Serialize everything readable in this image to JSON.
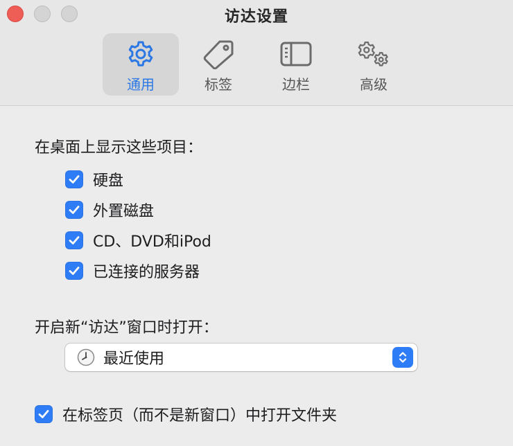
{
  "window": {
    "title": "访达设置"
  },
  "tabs": [
    {
      "label": "通用",
      "icon": "gear-icon",
      "active": true
    },
    {
      "label": "标签",
      "icon": "tag-icon",
      "active": false
    },
    {
      "label": "边栏",
      "icon": "sidebar-icon",
      "active": false
    },
    {
      "label": "高级",
      "icon": "gears-icon",
      "active": false
    }
  ],
  "desktop_section": {
    "label": "在桌面上显示这些项目：",
    "items": [
      {
        "label": "硬盘",
        "checked": true
      },
      {
        "label": "外置磁盘",
        "checked": true
      },
      {
        "label": "CD、DVD和iPod",
        "checked": true
      },
      {
        "label": "已连接的服务器",
        "checked": true
      }
    ]
  },
  "new_window_section": {
    "label": "开启新“访达”窗口时打开：",
    "selected_value": "最近使用",
    "icon": "clock-icon"
  },
  "open_in_tabs": {
    "label": "在标签页（而不是新窗口）中打开文件夹",
    "checked": true
  },
  "colors": {
    "accent": "#2f7df6",
    "active_tab_text": "#2b78e4",
    "close_button": "#ee5e57"
  }
}
